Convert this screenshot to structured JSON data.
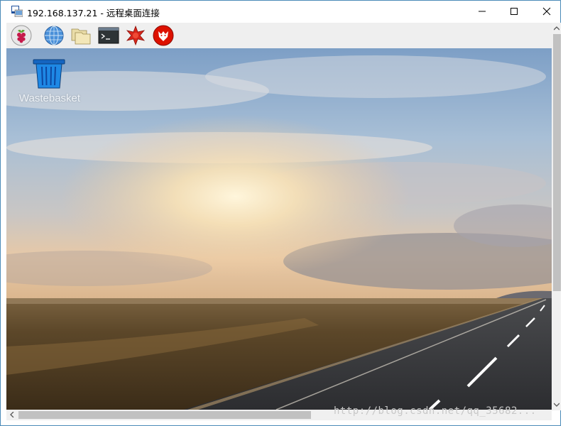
{
  "window": {
    "title": "192.168.137.21 - 远程桌面连接",
    "controls": {
      "minimize": "—",
      "maximize": "☐",
      "close": "✕"
    }
  },
  "taskbar": {
    "icons": [
      {
        "name": "raspberry-menu-icon"
      },
      {
        "name": "web-browser-icon"
      },
      {
        "name": "file-manager-icon"
      },
      {
        "name": "terminal-icon"
      },
      {
        "name": "mathematica-icon"
      },
      {
        "name": "wolfram-icon"
      }
    ]
  },
  "desktop": {
    "icons": [
      {
        "label": "Wastebasket",
        "icon": "wastebasket-icon"
      }
    ]
  },
  "watermark": "http://blog.csdn.net/qq_35682...",
  "colors": {
    "accent": "#2f7fc1",
    "sky_top": "#7a9cc4",
    "ground": "#4d3a22"
  }
}
